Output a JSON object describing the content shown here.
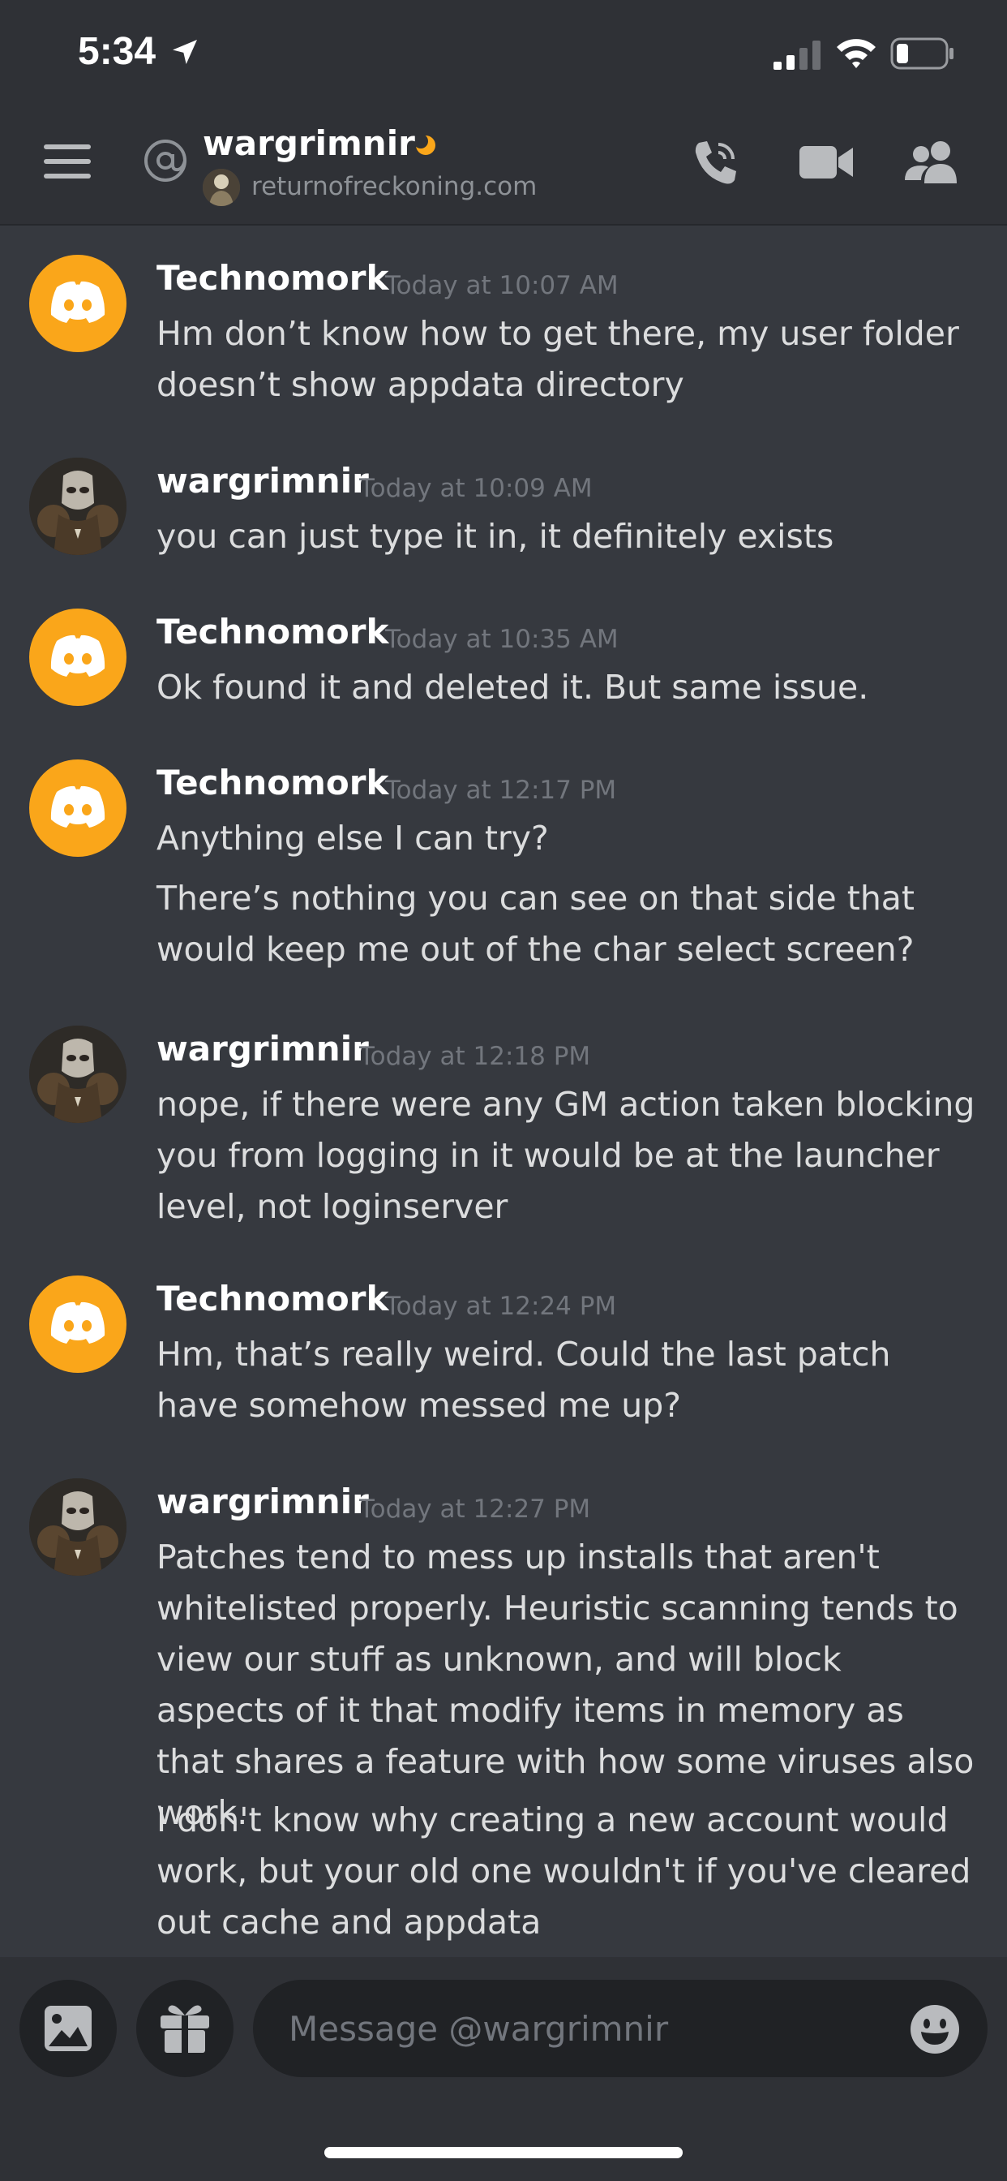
{
  "status_bar": {
    "time": "5:34"
  },
  "header": {
    "channel_name": "wargrimnir",
    "status_text": "returnofreckoning.com"
  },
  "messages": [
    {
      "author": "Technomork",
      "timestamp": "Today at 10:07 AM",
      "avatar": "discord-logo",
      "lines": [
        "Hm don’t know how to get there, my user folder doesn’t show appdata directory"
      ]
    },
    {
      "author": "wargrimnir",
      "timestamp": "Today at 10:09 AM",
      "avatar": "user-photo",
      "lines": [
        "you can just type it in, it definitely exists"
      ]
    },
    {
      "author": "Technomork",
      "timestamp": "Today at 10:35 AM",
      "avatar": "discord-logo",
      "lines": [
        "Ok found it and deleted it. But same issue."
      ]
    },
    {
      "author": "Technomork",
      "timestamp": "Today at 12:17 PM",
      "avatar": "discord-logo",
      "lines": [
        "Anything else I can try?",
        "There’s nothing you can see on that side that would keep me out of the char select screen?"
      ]
    },
    {
      "author": "wargrimnir",
      "timestamp": "Today at 12:18 PM",
      "avatar": "user-photo",
      "lines": [
        "nope, if there were any GM action taken blocking you from logging in it would be at the launcher level, not loginserver"
      ]
    },
    {
      "author": "Technomork",
      "timestamp": "Today at 12:24 PM",
      "avatar": "discord-logo",
      "lines": [
        "Hm, that’s really weird. Could the last patch have somehow messed me up?"
      ]
    },
    {
      "author": "wargrimnir",
      "timestamp": "Today at 12:27 PM",
      "avatar": "user-photo",
      "lines": [
        "Patches tend to mess up installs that aren't whitelisted properly. Heuristic scanning tends to view our stuff as unknown, and will block aspects of it that modify items in memory as that shares a feature with how some viruses also work.",
        "I don't know why creating a new account would work, but your old one wouldn't if you've cleared out cache and appdata"
      ]
    }
  ],
  "composer": {
    "placeholder": "Message @wargrimnir"
  },
  "colors": {
    "background": "#36393f",
    "header": "#2f3136",
    "discord_avatar": "#faa61a",
    "input": "#202225",
    "idle_status": "#faa61a"
  },
  "icons": [
    "location-arrow-icon",
    "signal-icon",
    "wifi-icon",
    "battery-icon",
    "hamburger-menu-icon",
    "at-sign-icon",
    "moon-idle-icon",
    "voice-call-icon",
    "video-call-icon",
    "members-icon",
    "image-upload-icon",
    "gift-icon",
    "emoji-icon"
  ]
}
